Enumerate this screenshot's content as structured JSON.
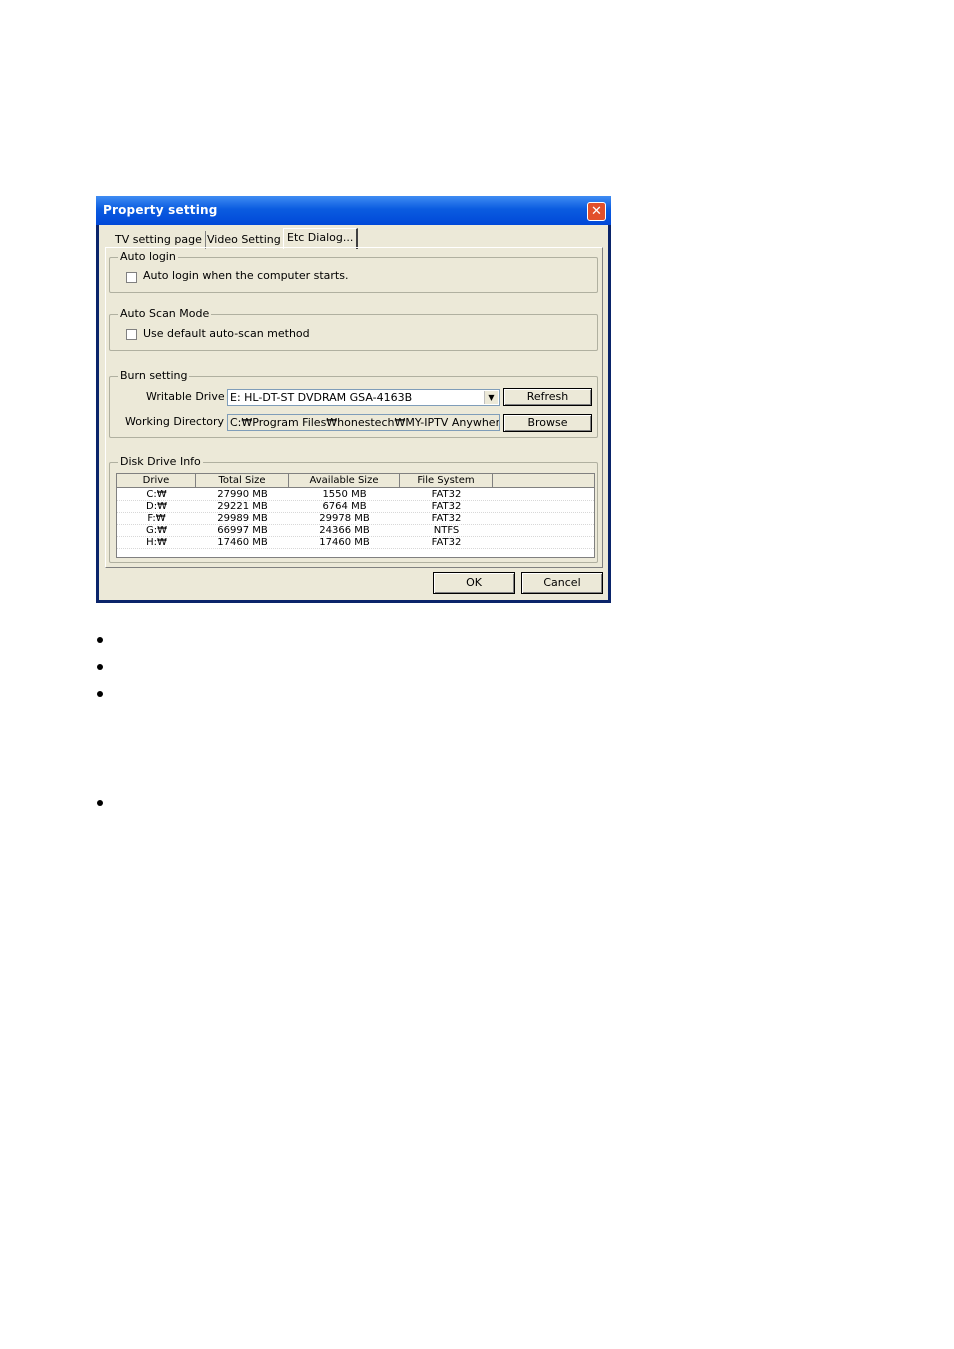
{
  "dialog": {
    "title": "Property setting",
    "close_glyph": "✕",
    "tabs": [
      {
        "label": "TV setting page"
      },
      {
        "label": "Video Setting"
      },
      {
        "label": "Etc Dialog..."
      }
    ],
    "auto_login": {
      "group_label": "Auto login",
      "checkbox_label": "Auto login when the computer starts.",
      "checked": false
    },
    "auto_scan": {
      "group_label": "Auto Scan Mode",
      "checkbox_label": "Use default auto-scan method",
      "checked": false
    },
    "burn": {
      "group_label": "Burn setting",
      "writable_drive_label": "Writable Drive :",
      "writable_drive_value": "E: HL-DT-ST DVDRAM GSA-4163B",
      "refresh_label": "Refresh",
      "working_dir_label": "Working Directory :",
      "working_dir_value": "C:₩Program Files₩honestech₩MY-IPTV Anywhere",
      "browse_label": "Browse"
    },
    "disk_info": {
      "group_label": "Disk Drive Info",
      "columns": [
        "Drive",
        "Total Size",
        "Available Size",
        "File System"
      ],
      "rows": [
        [
          "C:₩",
          "27990 MB",
          "1550 MB",
          "FAT32"
        ],
        [
          "D:₩",
          "29221 MB",
          "6764 MB",
          "FAT32"
        ],
        [
          "F:₩",
          "29989 MB",
          "29978 MB",
          "FAT32"
        ],
        [
          "G:₩",
          "66997 MB",
          "24366 MB",
          "NTFS"
        ],
        [
          "H:₩",
          "17460 MB",
          "17460 MB",
          "FAT32"
        ]
      ]
    },
    "ok_label": "OK",
    "cancel_label": "Cancel"
  },
  "page": {
    "bullets": [
      "",
      "",
      "",
      ""
    ]
  },
  "icons": {
    "dropdown": "chevron-down-icon",
    "close": "close-icon"
  }
}
